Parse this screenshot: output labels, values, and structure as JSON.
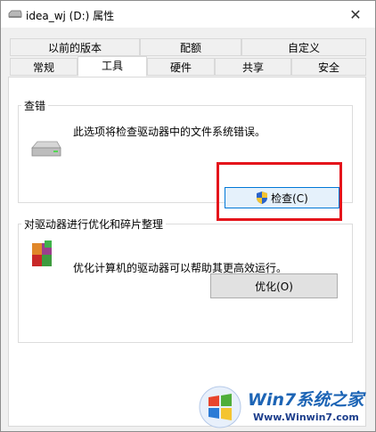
{
  "window": {
    "title": "idea_wj (D:) 属性",
    "close_symbol": "✕"
  },
  "tabs": {
    "row1": [
      "以前的版本",
      "配额",
      "自定义"
    ],
    "row2": [
      "常规",
      "工具",
      "硬件",
      "共享",
      "安全"
    ],
    "active": "工具"
  },
  "check_group": {
    "title": "查错",
    "description": "此选项将检查驱动器中的文件系统错误。",
    "button_label": "检查(C)"
  },
  "optimize_group": {
    "title": "对驱动器进行优化和碎片整理",
    "description": "优化计算机的驱动器可以帮助其更高效运行。",
    "button_label": "优化(O)"
  },
  "watermark": {
    "brand": "Win7系统之家",
    "url": "Www.Winwin7.com"
  },
  "colors": {
    "highlight": "#e4141b",
    "watermark_blue": "#1c64b5"
  },
  "icons": [
    "drive-icon",
    "shield-icon",
    "defrag-icon",
    "windows-logo-icon",
    "close-icon"
  ]
}
